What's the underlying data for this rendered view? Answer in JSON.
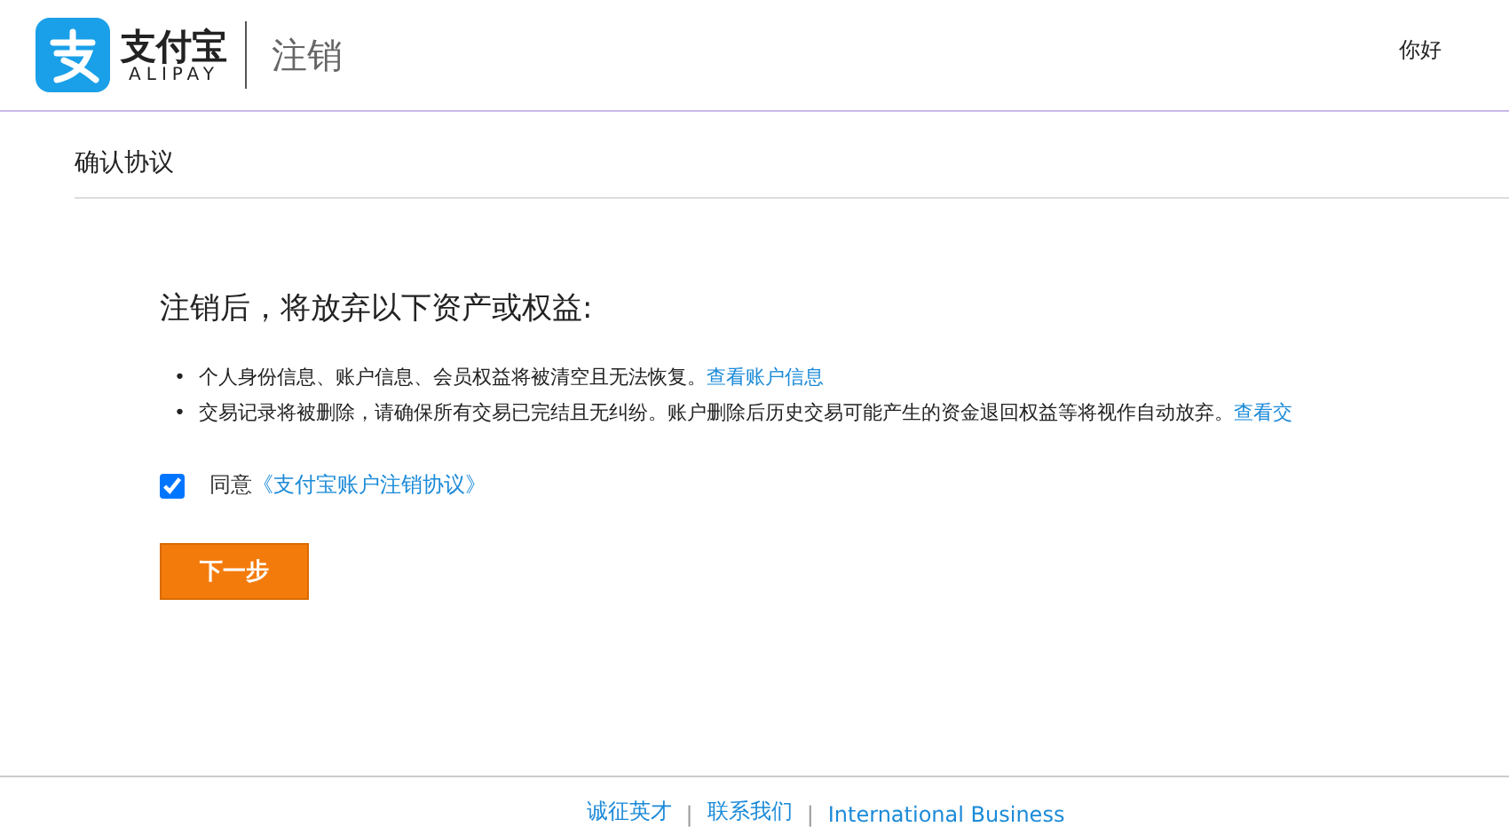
{
  "header": {
    "brand": "支付宝",
    "brand_sub": "ALIPAY",
    "page_title": "注销",
    "greeting": "你好"
  },
  "section_title": "确认协议",
  "heading": "注销后，将放弃以下资产或权益:",
  "items": [
    {
      "bullet": "•",
      "text": "个人身份信息、账户信息、会员权益将被清空且无法恢复。",
      "link": "查看账户信息"
    },
    {
      "bullet": "•",
      "text": "交易记录将被删除，请确保所有交易已完结且无纠纷。账户删除后历史交易可能产生的资金退回权益等将视作自动放弃。",
      "link": "查看交"
    }
  ],
  "agree": {
    "checked": true,
    "label": "同意",
    "link": "《支付宝账户注销协议》"
  },
  "next_button": "下一步",
  "footer": [
    {
      "kind": "link",
      "text": "诚征英才"
    },
    {
      "kind": "separator",
      "text": "|"
    },
    {
      "kind": "link",
      "text": "联系我们"
    },
    {
      "kind": "separator",
      "text": "|"
    },
    {
      "kind": "link",
      "text": "International Business"
    }
  ]
}
